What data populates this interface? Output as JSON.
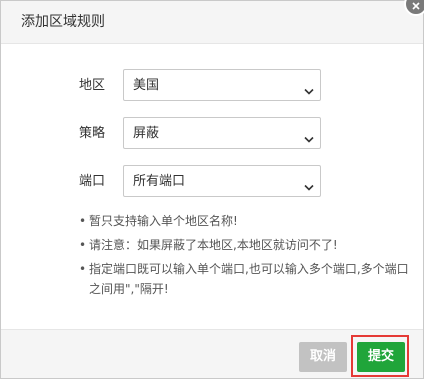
{
  "dialog": {
    "title": "添加区域规则"
  },
  "form": {
    "region": {
      "label": "地区",
      "value": "美国"
    },
    "strategy": {
      "label": "策略",
      "value": "屏蔽"
    },
    "port": {
      "label": "端口",
      "value": "所有端口"
    }
  },
  "tips": [
    "暂只支持输入单个地区名称!",
    "请注意：如果屏蔽了本地区,本地区就访问不了!",
    "指定端口既可以输入单个端口,也可以输入多个端口,多个端口之间用\",\"隔开!"
  ],
  "tip_bullet": "•",
  "footer": {
    "cancel_label": "取消",
    "submit_label": "提交"
  },
  "colors": {
    "submit": "#20a53a",
    "cancel": "#c2c2c2",
    "highlight": "#e53935",
    "close": "#7a7a7a"
  },
  "icons": {
    "close": "close-icon",
    "select_arrow": "chevron-down-icon"
  }
}
